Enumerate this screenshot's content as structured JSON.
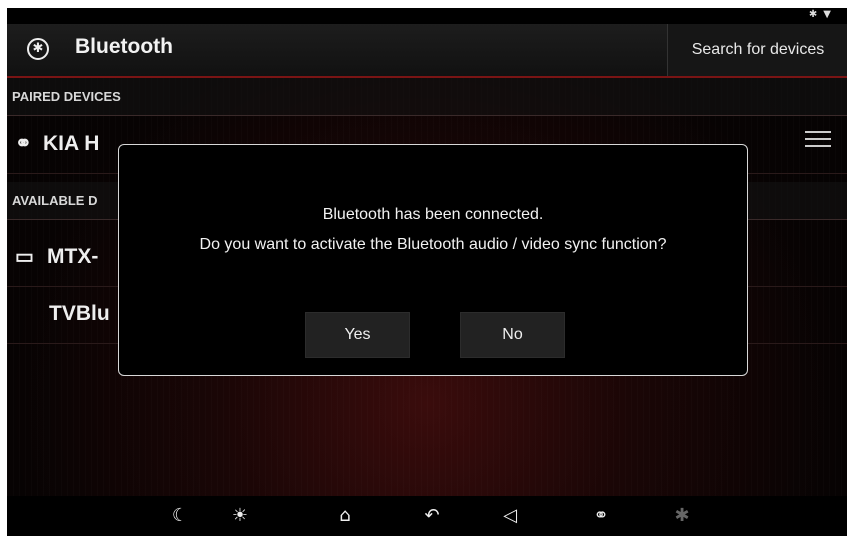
{
  "header": {
    "title": "Bluetooth",
    "search_label": "Search for devices"
  },
  "sections": {
    "paired": "PAIRED DEVICES",
    "available": "AVAILABLE D"
  },
  "devices": {
    "paired_0": "KIA H",
    "available_0": "MTX-",
    "available_1": "TVBlu"
  },
  "dialog": {
    "line1": "Bluetooth has been connected.",
    "line2": "Do you want to activate the Bluetooth audio / video sync function?",
    "yes": "Yes",
    "no": "No"
  },
  "icons": {
    "status": [
      "bluetooth-status-icon",
      "wifi-status-icon"
    ],
    "dock": [
      "moon-icon",
      "brightness-icon",
      "home-icon",
      "back-icon",
      "volume-icon",
      "headphone-bluetooth-icon",
      "bluetooth-audio-icon"
    ]
  },
  "colors": {
    "accent_line": "#7a1414",
    "dialog_border": "#d8d8d8",
    "background": "#1a0606"
  }
}
